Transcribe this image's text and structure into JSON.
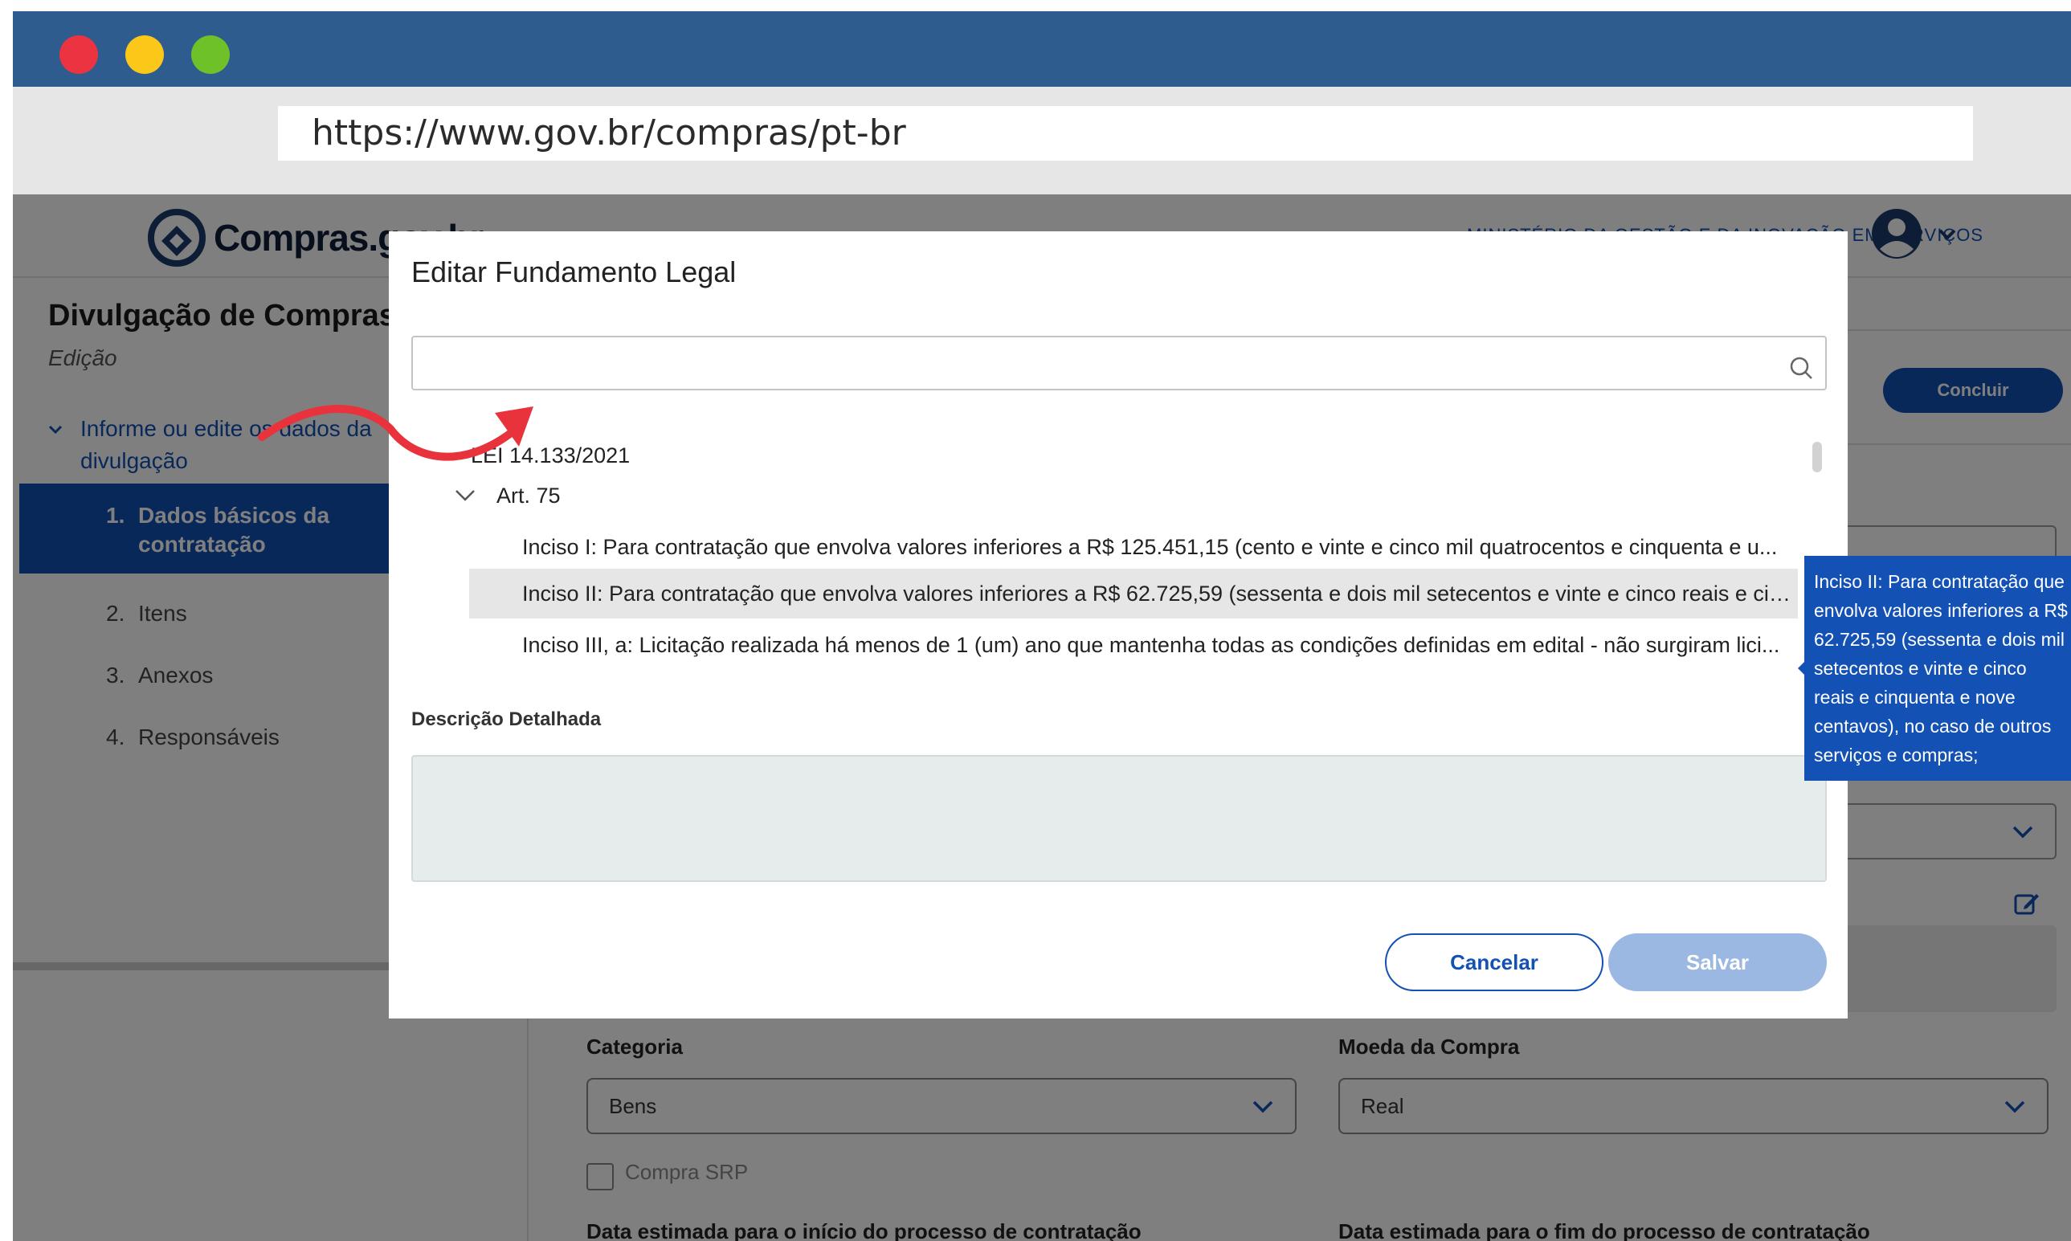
{
  "browser": {
    "url": "https://www.gov.br/compras/pt-br"
  },
  "header": {
    "logo_text": "Compras.gov.br",
    "ministry": "MINISTÉRIO DA GESTÃO E DA INOVAÇÃO EM SERVIÇOS PÚBLICOS"
  },
  "sidebar": {
    "title": "Divulgação de Compras",
    "subtitle": "Edição",
    "group_label": "Informe ou edite os dados da divulgação",
    "items": [
      {
        "num": "1.",
        "label": "Dados básicos da contratação",
        "active": true
      },
      {
        "num": "2.",
        "label": "Itens"
      },
      {
        "num": "3.",
        "label": "Anexos"
      },
      {
        "num": "4.",
        "label": "Responsáveis"
      }
    ]
  },
  "main": {
    "concluir_label": "Concluir",
    "categoria_label": "Categoria",
    "categoria_value": "Bens",
    "moeda_label": "Moeda da Compra",
    "moeda_value": "Real",
    "srp_label": "Compra SRP",
    "data_inicio_label": "Data estimada para o início do processo de contratação",
    "data_fim_label": "Data estimada para o fim do processo de contratação"
  },
  "modal": {
    "title": "Editar Fundamento Legal",
    "search_placeholder": "",
    "tree": {
      "law": "LEI 14.133/2021",
      "article": "Art. 75",
      "incisos": [
        "Inciso I: Para contratação que envolva valores inferiores a R$ 125.451,15 (cento e vinte e cinco mil quatrocentos e cinquenta e u...",
        "Inciso II: Para contratação que envolva valores inferiores a R$ 62.725,59 (sessenta e dois mil setecentos e vinte e cinco reais e cin...",
        "Inciso III, a: Licitação realizada há menos de 1 (um) ano que mantenha todas as condições definidas em edital - não surgiram lici..."
      ]
    },
    "description_label": "Descrição Detalhada",
    "cancel_label": "Cancelar",
    "save_label": "Salvar"
  },
  "tooltip": {
    "text": "Inciso II: Para contratação que envolva valores inferiores a R$ 62.725,59 (sessenta e dois mil setecentos e vinte e cinco reais e cinquenta e nove centavos), no caso de outros serviços e compras;"
  },
  "colors": {
    "titlebar": "#2e5c8e",
    "primary": "#1351b4",
    "tooltip_bg": "#1351b4",
    "save_disabled": "#9bb8e2",
    "arrow": "#e8323c"
  }
}
